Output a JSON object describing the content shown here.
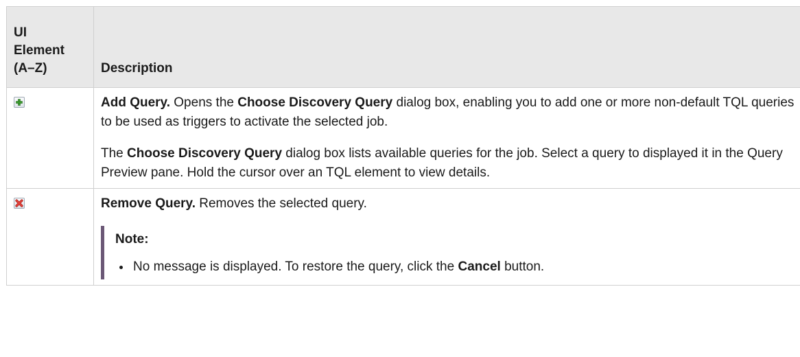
{
  "table": {
    "header": {
      "col1_line1": "UI",
      "col1_line2": "Element",
      "col1_line3": "(A–Z)",
      "col2": "Description"
    },
    "rows": [
      {
        "icon": "add-icon",
        "icon_color": "#3a9b2e",
        "p1_title": "Add Query.",
        "p1_text1": " Opens the ",
        "p1_bold": "Choose Discovery Query",
        "p1_text2": " dialog box, enabling you to add one or more non-default TQL queries to be used as triggers to activate the selected job.",
        "p2_text1": "The ",
        "p2_bold": "Choose Discovery Query",
        "p2_text2": " dialog box lists available queries for the job. Select a query to displayed it in the Query Preview pane. Hold the cursor over an TQL element to view details."
      },
      {
        "icon": "remove-icon",
        "icon_color": "#d9342b",
        "p1_title": "Remove Query.",
        "p1_text1": " Removes the selected query.",
        "note_title": "Note:",
        "note_text1": "No message is displayed. To restore the query, click the ",
        "note_bold": "Cancel",
        "note_text2": " button."
      }
    ]
  }
}
